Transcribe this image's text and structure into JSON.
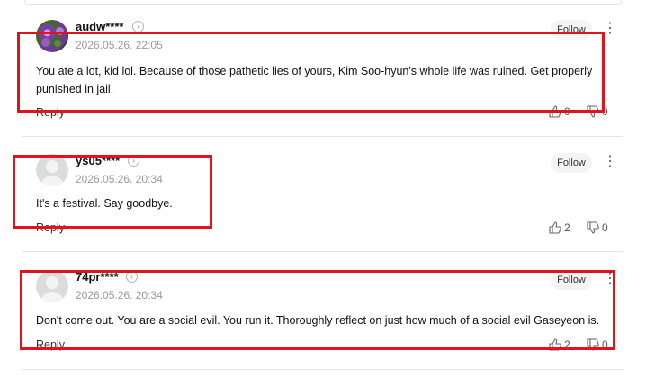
{
  "comments": [
    {
      "nickname": "audw****",
      "date": "2026.05.26. 22:05",
      "follow_label": "Follow",
      "text": "You ate a lot, kid lol. Because of those pathetic lies of yours, Kim Soo-hyun's whole life was ruined. Get properly punished in jail.",
      "reply_label": "Reply",
      "likes": "0",
      "dislikes": "0"
    },
    {
      "nickname": "ys05****",
      "date": "2026.05.26. 20:34",
      "follow_label": "Follow",
      "text": "It's a festival. Say goodbye.",
      "reply_label": "Reply",
      "likes": "2",
      "dislikes": "0"
    },
    {
      "nickname": "74pr****",
      "date": "2026.05.26. 20:34",
      "follow_label": "Follow",
      "text": "Don't come out. You are a social evil. You run it. Thoroughly reflect on just how much of a social evil Gaseyeon is.",
      "reply_label": "Reply",
      "likes": "2",
      "dislikes": "0"
    }
  ],
  "icons": {
    "nickname_more": "chevron-right-icon",
    "menu": "more-vertical-icon",
    "like": "thumbs-up-icon",
    "dislike": "thumbs-down-icon",
    "avatar_default": "default-avatar-icon"
  },
  "colors": {
    "highlight_box": "#e0141b",
    "date": "#9a9a9a",
    "follow_bg": "#f4f4f4"
  }
}
